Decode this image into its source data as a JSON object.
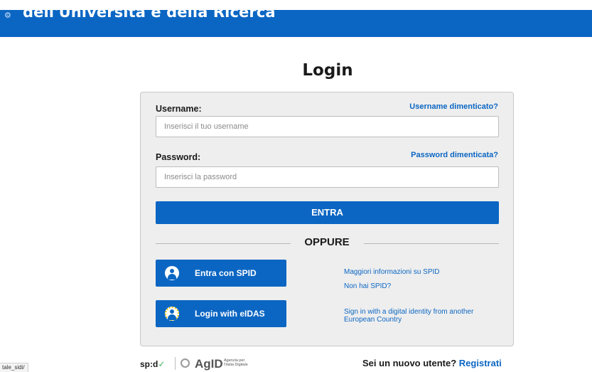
{
  "header": {
    "title": "dell'Università e della Ricerca"
  },
  "page": {
    "title": "Login"
  },
  "form": {
    "username_label": "Username:",
    "username_forgot": "Username dimenticato?",
    "username_placeholder": "Inserisci il tuo username",
    "password_label": "Password:",
    "password_forgot": "Password dimenticata?",
    "password_placeholder": "Inserisci la password",
    "submit_label": "ENTRA",
    "separator": "OPPURE"
  },
  "spid": {
    "button_label": "Entra con SPID",
    "info_link": "Maggiori informazioni su SPID",
    "no_spid_link": "Non hai SPID?"
  },
  "eidas": {
    "button_label": "Login with eIDAS",
    "info_line1": "Sign in with a digital identity from another",
    "info_line2": "European Country"
  },
  "footer": {
    "spid_logo": "sp:d",
    "agid_logo": "AgID",
    "agid_sub1": "Agenzia per",
    "agid_sub2": "l'Italia Digitale",
    "register_prompt": "Sei un nuovo utente?",
    "register_link": "Registrati"
  },
  "status_bar": {
    "url": "tale_sidi/"
  },
  "colors": {
    "accent": "#0b66c3",
    "card_bg": "#eeeeee"
  }
}
